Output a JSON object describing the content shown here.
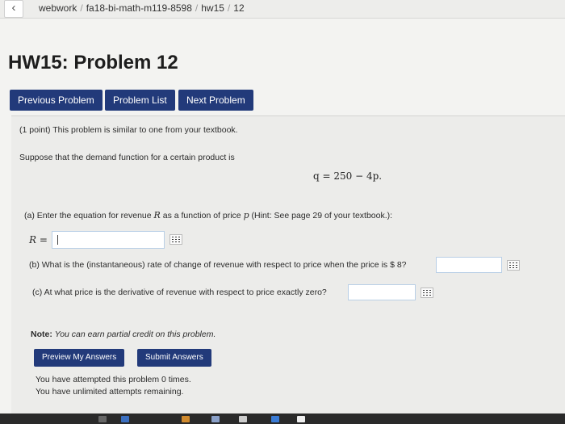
{
  "breadcrumb": {
    "course": "webwork",
    "section": "fa18-bi-math-m119-8598",
    "set": "hw15",
    "problem": "12"
  },
  "page_title": "HW15: Problem 12",
  "nav": {
    "previous": "Previous Problem",
    "list": "Problem List",
    "next": "Next Problem"
  },
  "problem": {
    "intro": "(1 point) This problem is similar to one from your textbook.",
    "demand_text": "Suppose that the demand function for a certain product is",
    "equation": "q = 250 − 4p.",
    "part_a_pre": "(a) Enter the equation for revenue",
    "part_a_var": "R",
    "part_a_mid": "as a function of price",
    "part_a_var2": "p",
    "part_a_post": "(Hint: See page 29 of your textbook.):",
    "answer_label": "R =",
    "part_b": "(b) What is the (instantaneous) rate of change of revenue with respect to price when the price is $ 8?",
    "part_c": "(c) At what price is the derivative of revenue with respect to price exactly zero?",
    "note_label": "Note:",
    "note_text": "You can earn partial credit on this problem."
  },
  "actions": {
    "preview": "Preview My Answers",
    "submit": "Submit Answers"
  },
  "status": {
    "attempted": "You have attempted this problem 0 times.",
    "remaining": "You have unlimited attempts remaining."
  },
  "colors": {
    "button": "#223a7a",
    "input_border": "#b9cfe6"
  }
}
